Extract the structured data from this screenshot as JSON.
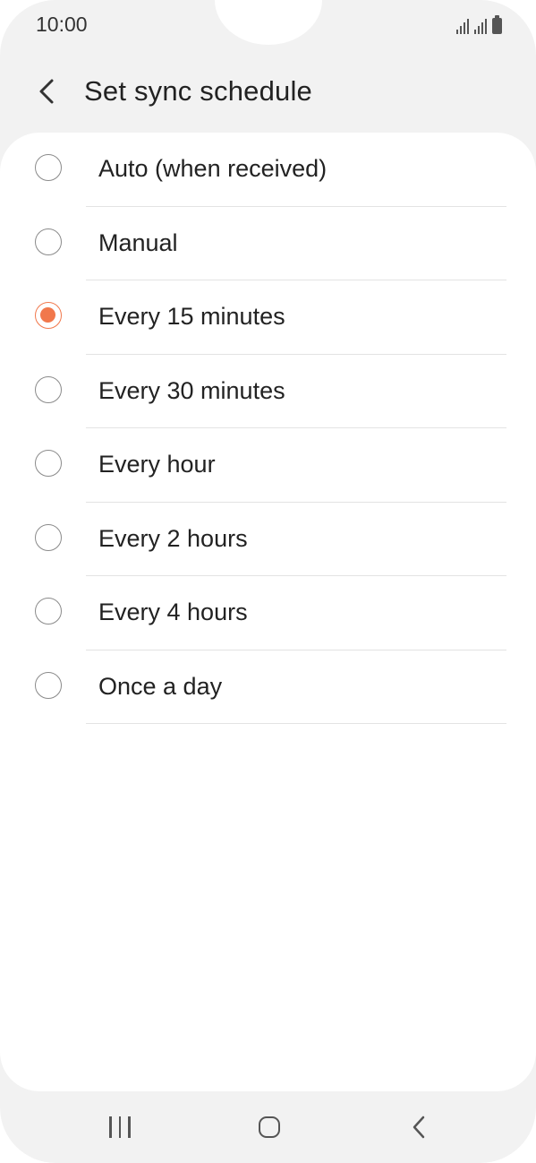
{
  "status_bar": {
    "time": "10:00",
    "icons": [
      "signal-icon",
      "signal-icon",
      "battery-icon"
    ]
  },
  "header": {
    "back_icon": "chevron-left-icon",
    "title": "Set sync schedule"
  },
  "options": [
    {
      "label": "Auto (when received)",
      "selected": false
    },
    {
      "label": "Manual",
      "selected": false
    },
    {
      "label": "Every 15 minutes",
      "selected": true
    },
    {
      "label": "Every 30 minutes",
      "selected": false
    },
    {
      "label": "Every hour",
      "selected": false
    },
    {
      "label": "Every 2 hours",
      "selected": false
    },
    {
      "label": "Every 4 hours",
      "selected": false
    },
    {
      "label": "Once a day",
      "selected": false
    }
  ],
  "nav_bar": {
    "recents_icon": "recents-icon",
    "home_icon": "home-icon",
    "back_icon": "back-icon"
  },
  "colors": {
    "accent": "#f1784c",
    "background": "#f2f2f2",
    "card": "#ffffff",
    "text": "#222222"
  }
}
